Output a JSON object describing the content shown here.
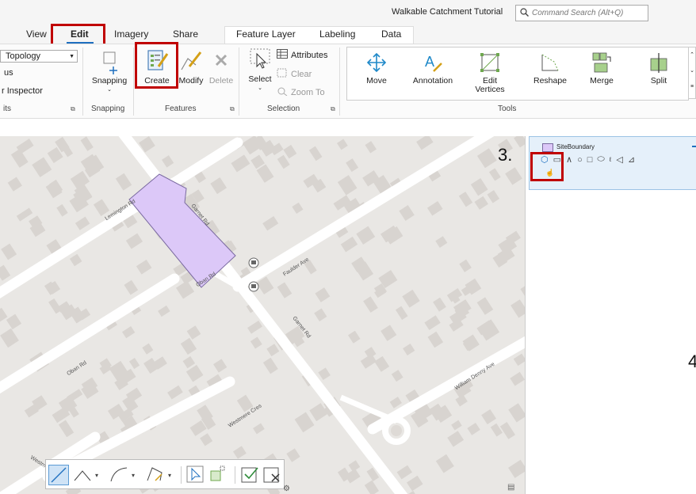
{
  "title_bar": {
    "project_name": "Walkable Catchment Tutorial",
    "search_placeholder": "Command Search (Alt+Q)"
  },
  "ribbon": {
    "tabs": [
      "View",
      "Edit",
      "Imagery",
      "Share",
      "Feature Layer",
      "Labeling",
      "Data"
    ],
    "active_tab": "Edit",
    "left_partial": {
      "topology_select": "Topology",
      "row2": "us",
      "row3": "r Inspector",
      "group_label": "its"
    },
    "snapping": {
      "label": "Snapping",
      "group_label": "Snapping"
    },
    "features": {
      "create_label": "Create",
      "modify_label": "Modify",
      "delete_label": "Delete",
      "group_label": "Features"
    },
    "selection": {
      "select_label": "Select",
      "attributes_label": "Attributes",
      "clear_label": "Clear",
      "zoom_to_label": "Zoom To",
      "group_label": "Selection"
    },
    "tools": {
      "items": [
        "Move",
        "Annotation",
        "Edit\nVertices",
        "Reshape",
        "Merge",
        "Split"
      ],
      "group_label": "Tools"
    }
  },
  "map": {
    "road_labels": {
      "lemington": "Lemington Rd",
      "garnet_top": "Garnet Rd",
      "oban_top": "Oban Rd",
      "faulder": "Faulder Ave",
      "garnet_mid": "Garnet Rd",
      "oban_left": "Oban Rd",
      "westmere": "Westmere Cres",
      "william_denny": "William Denny Ave",
      "westm_partial": "Westm"
    },
    "polygon_fill": "#dcc8f8",
    "polygon_stroke": "#7a6aa0"
  },
  "create_features_panel": {
    "layer_name": "SiteBoundary",
    "layer_swatch": "#dcc8f8"
  },
  "annotations": {
    "step3": "3.",
    "step4": "4"
  },
  "colors": {
    "highlight_red": "#c00000",
    "accent_blue": "#1e6fbf"
  }
}
